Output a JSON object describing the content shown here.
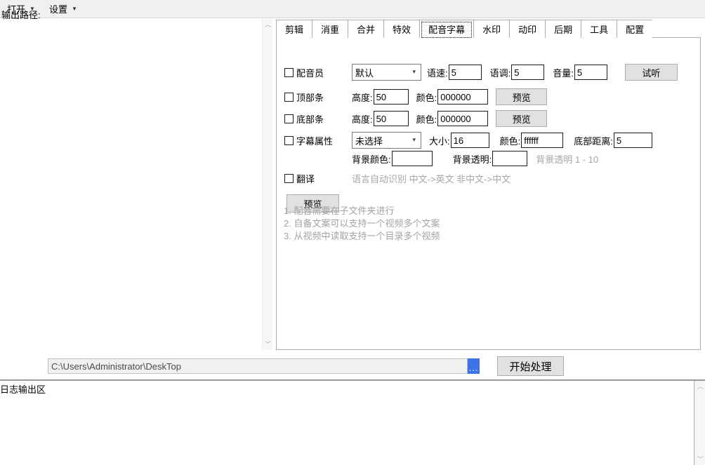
{
  "menubar": {
    "items": [
      {
        "label": "打开",
        "caret": "▼"
      },
      {
        "label": "设置",
        "caret": "▼"
      }
    ]
  },
  "tabs": [
    {
      "label": "剪辑",
      "active": false
    },
    {
      "label": "消重",
      "active": false
    },
    {
      "label": "合并",
      "active": false
    },
    {
      "label": "特效",
      "active": false
    },
    {
      "label": "配音字幕",
      "active": true
    },
    {
      "label": "水印",
      "active": false
    },
    {
      "label": "动印",
      "active": false
    },
    {
      "label": "后期",
      "active": false
    },
    {
      "label": "工具",
      "active": false
    },
    {
      "label": "配置",
      "active": false
    }
  ],
  "form": {
    "voice_row": {
      "checkbox_label": "配音员",
      "voice_select_value": "默认",
      "speed_label": "语速:",
      "speed_value": "5",
      "pitch_label": "语调:",
      "pitch_value": "5",
      "volume_label": "音量:",
      "volume_value": "5",
      "preview_audio_button": "试听"
    },
    "top_bar_row": {
      "checkbox_label": "顶部条",
      "height_label": "高度:",
      "height_value": "50",
      "color_label": "颜色:",
      "color_value": "000000",
      "preview_button": "预览"
    },
    "bottom_bar_row": {
      "checkbox_label": "底部条",
      "height_label": "高度:",
      "height_value": "50",
      "color_label": "颜色:",
      "color_value": "000000",
      "preview_button": "预览"
    },
    "subtitle_row": {
      "checkbox_label": "字幕属性",
      "font_select_value": "未选择",
      "size_label": "大小:",
      "size_value": "16",
      "color_label": "颜色:",
      "color_value": "ffffff",
      "bottom_distance_label": "底部距离:",
      "bottom_distance_value": "5"
    },
    "background_row": {
      "bg_color_label": "背景颜色:",
      "bg_color_value": "",
      "bg_alpha_label": "背景透明:",
      "bg_alpha_value": "",
      "bg_alpha_hint": "背景透明 1 - 10"
    },
    "translate_row": {
      "checkbox_label": "翻译",
      "hint": "语言自动识别 中文->英文 非中文->中文"
    },
    "preview_button": "预览"
  },
  "notes": [
    "1. 配音需要在子文件夹进行",
    "2. 自备文案可以支持一个视频多个文案",
    "3. 从视频中读取支持一个目录多个视频"
  ],
  "output": {
    "path_label": "输出路径:",
    "path_value": "C:\\Users\\Administrator\\DeskTop",
    "browse_button": "...",
    "start_button": "开始处理"
  },
  "log": {
    "label": "日志输出区",
    "content": ""
  },
  "scrollbar": {
    "up_arrow": "︿",
    "down_arrow": "﹀"
  },
  "colors": {
    "accent_blue": "#3d72e8",
    "menubar_bg": "#f0f0f0",
    "button_bg": "#e1e1e1",
    "hint_gray": "#a6a6a6"
  }
}
